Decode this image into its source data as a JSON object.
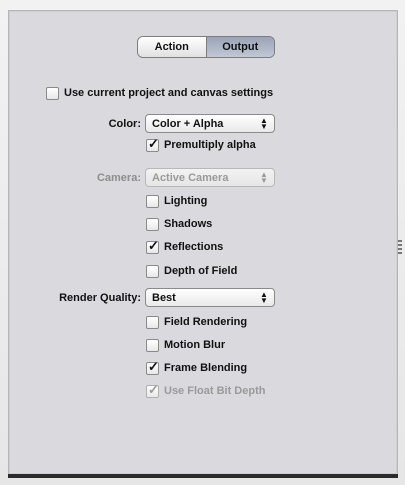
{
  "tabs": [
    {
      "label": "Action",
      "selected": false
    },
    {
      "label": "Output",
      "selected": true
    }
  ],
  "use_current_settings": {
    "label": "Use current project and canvas settings",
    "checked": false
  },
  "color": {
    "label": "Color:",
    "value": "Color + Alpha"
  },
  "premultiply_alpha": {
    "label": "Premultiply alpha",
    "checked": true
  },
  "camera": {
    "label": "Camera:",
    "value": "Active Camera",
    "disabled": true
  },
  "lighting": {
    "label": "Lighting",
    "checked": false
  },
  "shadows": {
    "label": "Shadows",
    "checked": false
  },
  "reflections": {
    "label": "Reflections",
    "checked": true
  },
  "depth_of_field": {
    "label": "Depth of Field",
    "checked": false
  },
  "render_quality": {
    "label": "Render Quality:",
    "value": "Best"
  },
  "field_rendering": {
    "label": "Field Rendering",
    "checked": false
  },
  "motion_blur": {
    "label": "Motion Blur",
    "checked": false
  },
  "frame_blending": {
    "label": "Frame Blending",
    "checked": true
  },
  "float_bit_depth": {
    "label": "Use Float Bit Depth",
    "checked": true,
    "disabled": true
  },
  "icons": {
    "popup_arrows": "up-down-arrows-icon",
    "checkmark": "checkmark-icon"
  }
}
